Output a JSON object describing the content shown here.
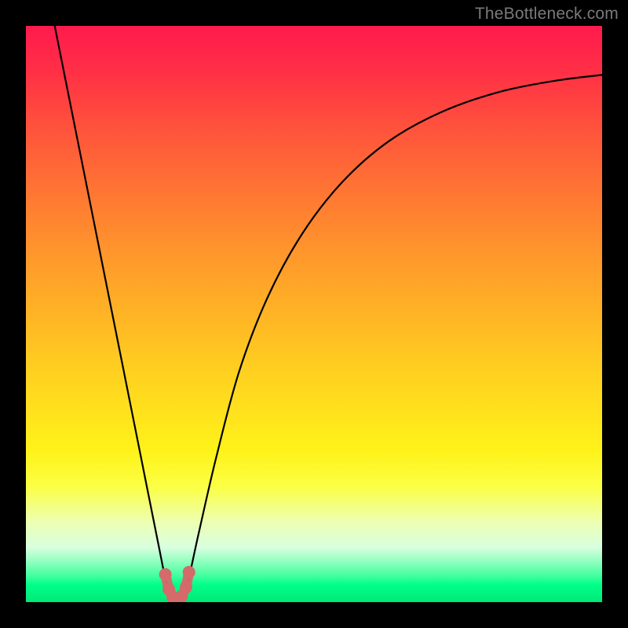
{
  "watermark": "TheBottleneck.com",
  "chart_data": {
    "type": "line",
    "title": "",
    "xlabel": "",
    "ylabel": "",
    "xlim": [
      0,
      100
    ],
    "ylim": [
      0,
      100
    ],
    "grid": false,
    "legend": false,
    "series": [
      {
        "name": "bottleneck-curve",
        "color": "#000000",
        "x": [
          5,
          8,
          11,
          14,
          17,
          20,
          23,
          24.5,
          26,
          27,
          28,
          30,
          33,
          37,
          42,
          48,
          55,
          63,
          72,
          82,
          92,
          100
        ],
        "y": [
          100,
          85,
          70,
          55,
          40,
          25,
          10,
          3,
          0.5,
          0.5,
          3,
          12,
          25,
          40,
          53,
          64,
          73,
          80,
          85,
          88.5,
          90.5,
          91.5
        ]
      },
      {
        "name": "optimal-zone-marker",
        "color": "#d46a6a",
        "type": "scatter",
        "x": [
          24.2,
          24.8,
          25.5,
          26.2,
          27.0,
          27.8,
          28.3
        ],
        "y": [
          4.8,
          2.2,
          0.8,
          0.6,
          1.0,
          2.6,
          5.2
        ]
      }
    ],
    "background_gradient": {
      "top": "#ff1a4d",
      "mid": "#fff31a",
      "bottom": "#00e878"
    }
  }
}
